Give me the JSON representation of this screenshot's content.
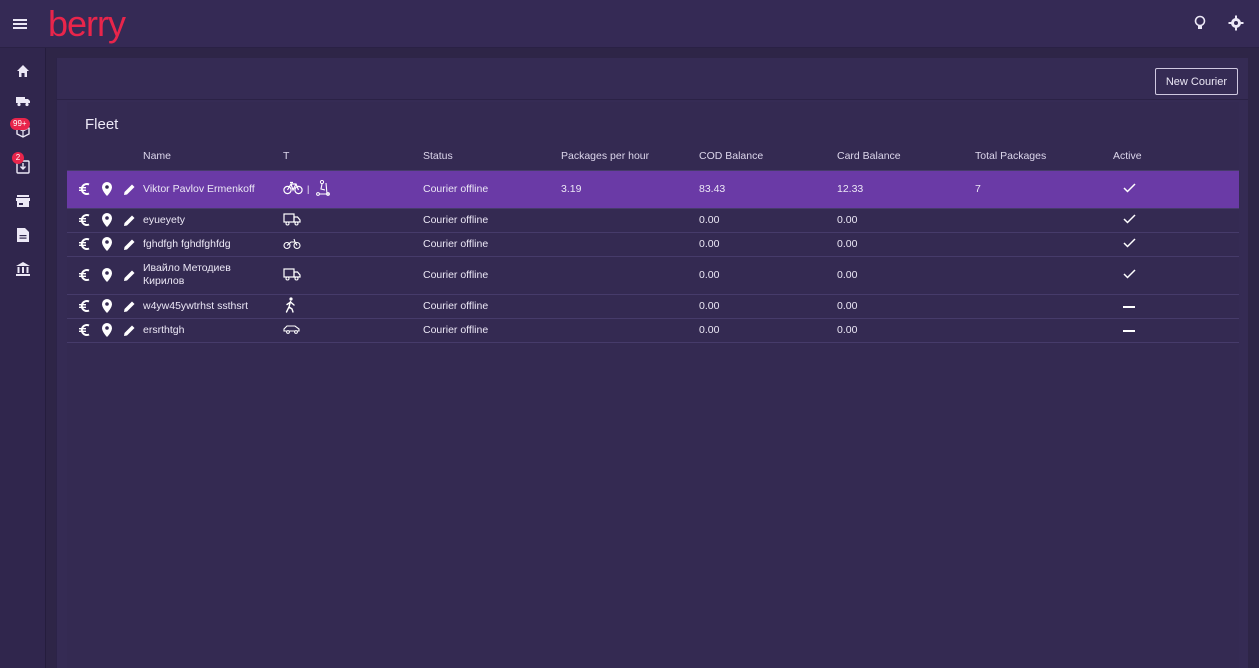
{
  "app": {
    "logo_text": "berry",
    "brand_color": "#e8254b",
    "accent_color": "#6a3aa6"
  },
  "topbar": {
    "icons": [
      "menu-icon",
      "lightbulb-icon",
      "gear-icon"
    ]
  },
  "sidebar": {
    "items": [
      {
        "icon": "home-icon"
      },
      {
        "icon": "truck-icon"
      },
      {
        "icon": "package-icon",
        "badge": "99+"
      },
      {
        "icon": "download-box-icon",
        "badge": "2"
      },
      {
        "icon": "store-icon"
      },
      {
        "icon": "document-icon"
      },
      {
        "icon": "bank-icon"
      }
    ]
  },
  "toolbar": {
    "new_courier_label": "New Courier"
  },
  "fleet": {
    "title": "Fleet",
    "columns": [
      "Name",
      "T",
      "Status",
      "Packages per hour",
      "COD Balance",
      "Card Balance",
      "Total Packages",
      "Active"
    ],
    "rows": [
      {
        "name": "Viktor Pavlov Ermenkoff",
        "transport": [
          "bicycle-icon",
          "scooter-icon"
        ],
        "status": "Courier offline",
        "pph": "3.19",
        "cod": "83.43",
        "card": "12.33",
        "total": "7",
        "active": true,
        "selected": true
      },
      {
        "name": "eyueyety",
        "transport": [
          "truck-icon"
        ],
        "status": "Courier offline",
        "pph": "",
        "cod": "0.00",
        "card": "0.00",
        "total": "",
        "active": true,
        "selected": false
      },
      {
        "name": "fghdfgh fghdfghfdg",
        "transport": [
          "motorbike-icon"
        ],
        "status": "Courier offline",
        "pph": "",
        "cod": "0.00",
        "card": "0.00",
        "total": "",
        "active": true,
        "selected": false
      },
      {
        "name": "Ивайло Методиев Кирилов",
        "transport": [
          "truck-icon"
        ],
        "status": "Courier offline",
        "pph": "",
        "cod": "0.00",
        "card": "0.00",
        "total": "",
        "active": true,
        "selected": false
      },
      {
        "name": "w4yw45ywtrhst ssthsrt",
        "transport": [
          "walking-icon"
        ],
        "status": "Courier offline",
        "pph": "",
        "cod": "0.00",
        "card": "0.00",
        "total": "",
        "active": false,
        "selected": false
      },
      {
        "name": "ersrthtgh",
        "transport": [
          "car-icon"
        ],
        "status": "Courier offline",
        "pph": "",
        "cod": "0.00",
        "card": "0.00",
        "total": "",
        "active": false,
        "selected": false
      }
    ]
  }
}
